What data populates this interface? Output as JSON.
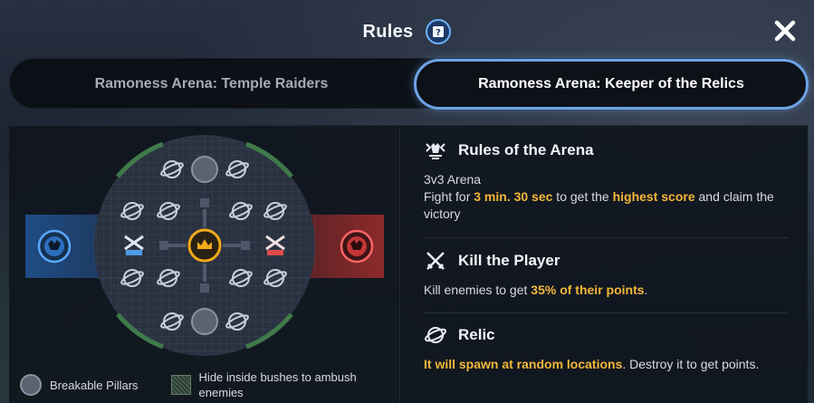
{
  "header": {
    "title": "Rules",
    "help_icon": "help-book-icon",
    "close_icon": "close-icon"
  },
  "tabs": [
    {
      "label": "Ramoness Arena: Temple Raiders",
      "selected": false
    },
    {
      "label": "Ramoness Arena: Keeper of the Relics",
      "selected": true
    }
  ],
  "map": {
    "team_blue_color": "#2f6fb6",
    "team_red_color": "#b23434",
    "center_color": "#f2a91a"
  },
  "legend": {
    "pillars": "Breakable Pillars",
    "bushes": "Hide inside bushes to ambush enemies"
  },
  "rules": {
    "arena": {
      "icon": "arena-crest-icon",
      "title": "Rules of the Arena",
      "line1": "3v3 Arena",
      "p1": "Fight for ",
      "h1": "3 min. 30 sec",
      "p2": " to get the ",
      "h2": "highest score",
      "p3": " and claim the victory"
    },
    "kill": {
      "icon": "crossed-swords-icon",
      "title": "Kill the Player",
      "p1": "Kill enemies to get ",
      "h1": "35% of their points",
      "p2": "."
    },
    "relic": {
      "icon": "relic-orb-icon",
      "title": "Relic",
      "h1": "It will spawn at random locations",
      "p1": ". Destroy it to get points."
    }
  },
  "colors": {
    "accent_highlight": "#f3b73a",
    "tab_border": "#6da3e6"
  }
}
